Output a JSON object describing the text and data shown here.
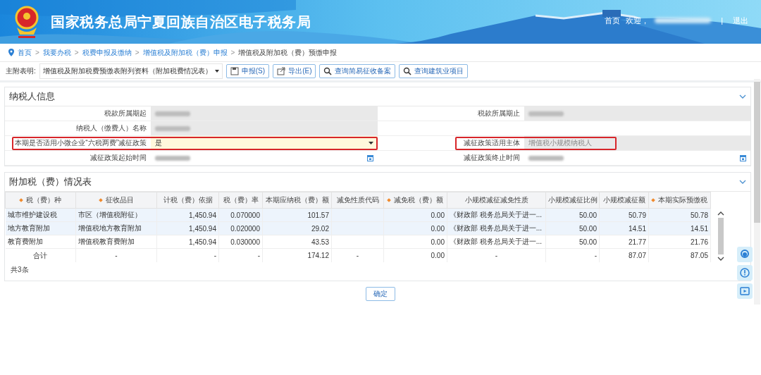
{
  "header": {
    "title": "国家税务总局宁夏回族自治区电子税务局",
    "home_link": "首页",
    "welcome": "欢迎，",
    "separator": "|",
    "logout": "退出"
  },
  "breadcrumb": [
    {
      "label": "首页",
      "current": false
    },
    {
      "label": "我要办税",
      "current": false
    },
    {
      "label": "税费申报及缴纳",
      "current": false
    },
    {
      "label": "增值税及附加税（费）申报",
      "current": false
    },
    {
      "label": "增值税及附加税（费）预缴申报",
      "current": true
    }
  ],
  "breadcrumb_separator": ">",
  "toolbar": {
    "label": "主附表明:",
    "select": "增值税及附加税费预缴表附列资料（附加税费情况表）",
    "buttons": [
      {
        "kind": "save",
        "label": "申报(S)"
      },
      {
        "kind": "export",
        "label": "导出(E)"
      },
      {
        "kind": "search",
        "label": "查询简易征收备案"
      },
      {
        "kind": "search",
        "label": "查询建筑业项目"
      }
    ]
  },
  "taxpayer_panel": {
    "title": "纳税人信息",
    "expanded": true,
    "rows": [
      [
        {
          "label": "税款所属期起",
          "kind": "readonly",
          "redacted": true,
          "highlighted": false
        },
        {
          "label": "税款所属期止",
          "kind": "readonly",
          "redacted": true,
          "highlighted": false
        }
      ],
      [
        {
          "label": "纳税人（缴费人）名称",
          "kind": "readonly",
          "redacted": true,
          "highlighted": false
        },
        {
          "kind": "blank"
        }
      ],
      [
        {
          "label": "本期是否适用小微企业“六税两费”减征政策",
          "kind": "select",
          "value": "是",
          "redacted": false,
          "highlighted": true
        },
        {
          "label": "减征政策适用主体",
          "kind": "readonly",
          "value": "增值税小规模纳税人",
          "redacted": false,
          "highlighted": true
        }
      ],
      [
        {
          "label": "减征政策起始时间",
          "kind": "date",
          "redacted": true,
          "highlighted": false
        },
        {
          "label": "减征政策终止时间",
          "kind": "date",
          "redacted": true,
          "highlighted": false
        }
      ]
    ]
  },
  "surcharge_panel": {
    "title": "附加税（费）情况表",
    "expanded": true,
    "columns": [
      {
        "label": "税（费）种",
        "required": true
      },
      {
        "label": "征收品目",
        "required": true
      },
      {
        "label": "计税（费）依据",
        "required": false
      },
      {
        "label": "税（费）率",
        "required": false
      },
      {
        "label": "本期应纳税（费）额",
        "required": false
      },
      {
        "label": "减免性质代码",
        "required": false
      },
      {
        "label": "减免税（费）额",
        "required": true
      },
      {
        "label": "小规模减征减免性质",
        "required": false
      },
      {
        "label": "小规模减征比例",
        "required": false
      },
      {
        "label": "小规模减征额",
        "required": false
      },
      {
        "label": "本期实际预缴税",
        "required": true
      }
    ],
    "rows": [
      {
        "highlighted": true,
        "cells": [
          "城市维护建设税",
          "市区（增值税附征）",
          "1,450.94",
          "0.070000",
          "101.57",
          "",
          "0.00",
          "《财政部 税务总局关于进一...",
          "50.00",
          "50.79",
          "50.78"
        ]
      },
      {
        "highlighted": true,
        "cells": [
          "地方教育附加",
          "增值税地方教育附加",
          "1,450.94",
          "0.020000",
          "29.02",
          "",
          "0.00",
          "《财政部 税务总局关于进一...",
          "50.00",
          "14.51",
          "14.51"
        ]
      },
      {
        "highlighted": false,
        "cells": [
          "教育费附加",
          "增值税教育费附加",
          "1,450.94",
          "0.030000",
          "43.53",
          "",
          "0.00",
          "《财政部 税务总局关于进一...",
          "50.00",
          "21.77",
          "21.76"
        ]
      }
    ],
    "total_row": [
      "合计",
      "-",
      "-",
      "-",
      "174.12",
      "-",
      "0.00",
      "-",
      "-",
      "87.07",
      "87.05"
    ],
    "record_count": "共3条"
  },
  "confirm_button": "确定"
}
